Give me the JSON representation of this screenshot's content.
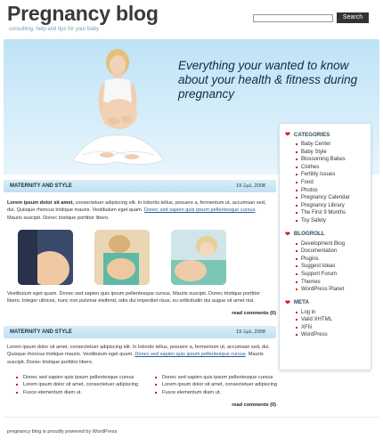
{
  "header": {
    "site_title": "Pregnancy blog",
    "tagline": "consulting, help and tips for your baby",
    "search_placeholder": "",
    "search_button": "Search"
  },
  "hero": {
    "headline": "Everything your wanted to know about your health & fitness during pregnancy"
  },
  "sidebar": {
    "categories_title": "CATEGORIES",
    "categories": [
      "Baby Center",
      "Baby Style",
      "Blossoming Babes",
      "Clothes",
      "Fertility Issues",
      "Food",
      "Photos",
      "Pregnancy Calendar",
      "Pregnancy Library",
      "The First 9 Months",
      "Toy Safety"
    ],
    "blogroll_title": "BLOGROLL",
    "blogroll": [
      "Development Blog",
      "Documentation",
      "Plugins",
      "Suggest Ideas",
      "Support Forum",
      "Themes",
      "WordPress Planet"
    ],
    "meta_title": "META",
    "meta": [
      "Log in",
      "Valid XHTML",
      "XFN",
      "WordPress"
    ]
  },
  "posts": [
    {
      "title": "MATERNITY AND STYLE",
      "date": "19 Ξµλ, 2008",
      "p1_bold": "Lorem ipsum dolor sit amet,",
      "p1_a": " consectetuer adipiscing elit. In lobortis tellus, posuere a, fermentum ut, accumsan sed, dui. Quisque rhoncus tristique mauris. Vestibulum eget quam. ",
      "p1_link": "Donec sed sapien quis ipsum pellentesque cursus",
      "p1_b": ". Mauris suscipit. Donec tristique porttitor libero.",
      "p2": "Vestibulum eget quam. Donec sed sapien quis ipsum pellentesque cursus. Mauris suscipit. Donec tristique porttitor libero. Integer ultrices, nunc non pulvinar eleifend, odio dui imperdiet risus, eu sollicitudin dui augue sit amet nisi.",
      "read_comments": "read comments (0)"
    },
    {
      "title": "MATERNITY AND STYLE",
      "date": "19 Ξµλ, 2008",
      "p1_bold": "Lorem ipsum dolor sit amet,",
      "p1_a": " consectetuer adipiscing elit. In lobortis tellus, posuere a, fermentum ut, accumsan sed, dui. Quisque rhoncus tristique mauris. Vestibulum eget quam. ",
      "p1_link": "Donec sed sapien quis ipsum pellentesque cursus",
      "p1_b": ". Mauris suscipit. Donec tristique porttitor libero.",
      "bullets_left": [
        "Donec sed sapien quis ipsum pellentesque cursus",
        "Lorem ipsum dolor sit amet, consectetuer adipiscing",
        "Fusce elementum diam ut."
      ],
      "bullets_right": [
        "Donec sed sapien quis ipsum pellentesque cursus",
        "Lorem ipsum dolor sit amet, consectetuer adipiscing",
        "Fusce elementum diam ut."
      ],
      "read_comments": "read comments (0)"
    }
  ],
  "footer": {
    "text": "pregnancy blog is proudly powered by WordPress"
  },
  "colors": {
    "accent_red": "#d0192b",
    "hero_blue": "#bfe2f6",
    "title_dark": "#3a3a3a"
  }
}
